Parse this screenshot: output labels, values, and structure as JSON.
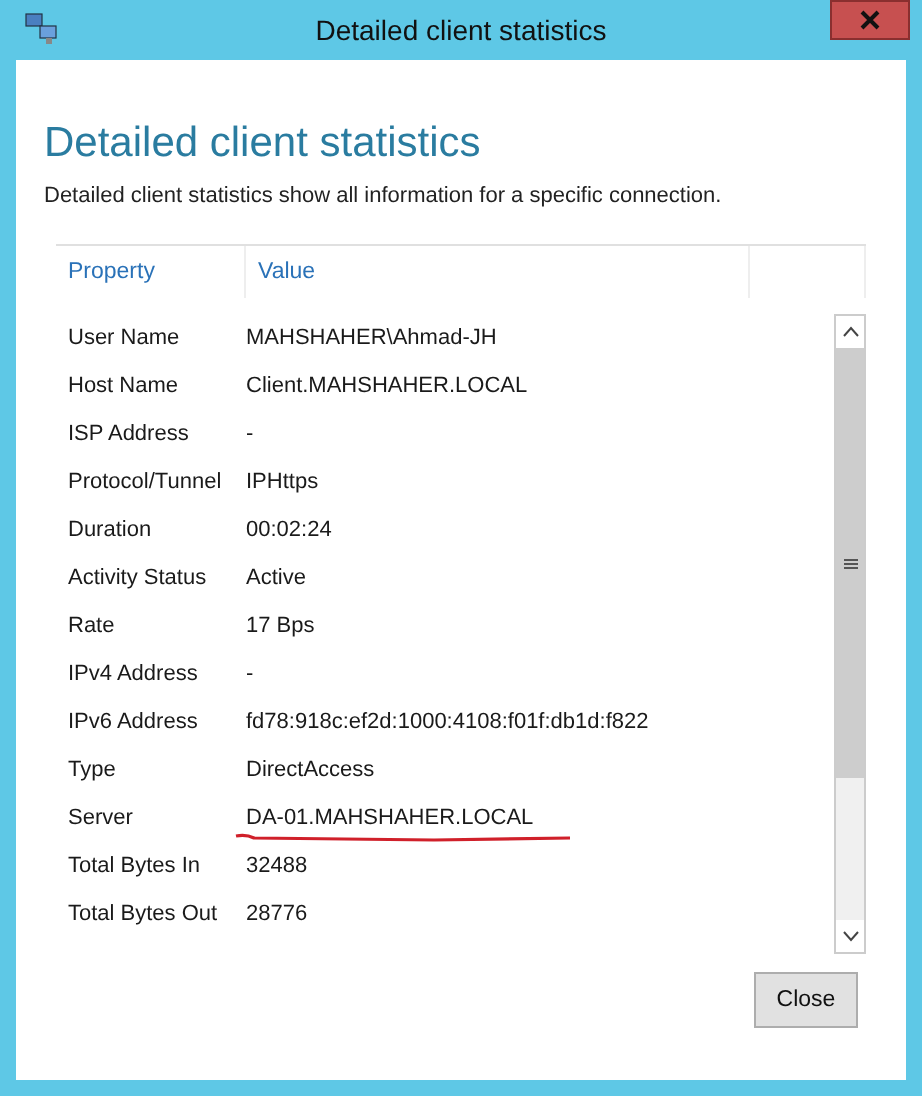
{
  "window": {
    "title": "Detailed client statistics"
  },
  "heading": "Detailed client statistics",
  "description": "Detailed client statistics show all information for a specific connection.",
  "table": {
    "columns": [
      "Property",
      "Value"
    ],
    "rows": [
      {
        "property": "User Name",
        "value": "MAHSHAHER\\Ahmad-JH",
        "underlined": false
      },
      {
        "property": "Host Name",
        "value": "Client.MAHSHAHER.LOCAL",
        "underlined": false
      },
      {
        "property": "ISP Address",
        "value": "-",
        "underlined": false
      },
      {
        "property": "Protocol/Tunnel",
        "value": "IPHttps",
        "underlined": false
      },
      {
        "property": "Duration",
        "value": "00:02:24",
        "underlined": false
      },
      {
        "property": "Activity Status",
        "value": "Active",
        "underlined": false
      },
      {
        "property": "Rate",
        "value": "17 Bps",
        "underlined": false
      },
      {
        "property": "IPv4 Address",
        "value": "-",
        "underlined": false
      },
      {
        "property": "IPv6 Address",
        "value": "fd78:918c:ef2d:1000:4108:f01f:db1d:f822",
        "underlined": false
      },
      {
        "property": "Type",
        "value": "DirectAccess",
        "underlined": false
      },
      {
        "property": "Server",
        "value": "DA-01.MAHSHAHER.LOCAL",
        "underlined": true
      },
      {
        "property": "Total Bytes In",
        "value": "32488",
        "underlined": false
      },
      {
        "property": "Total Bytes Out",
        "value": "28776",
        "underlined": false
      }
    ]
  },
  "buttons": [
    "Close"
  ]
}
